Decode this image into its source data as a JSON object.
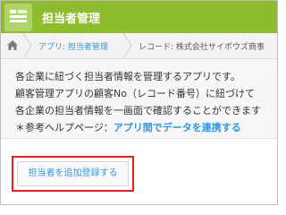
{
  "header": {
    "app_icon": "app-list-icon",
    "title": "担当者管理"
  },
  "breadcrumb": {
    "home_icon": "home-icon",
    "app": "アプリ: 担当者管理",
    "record": "レコード: 株式会社サイボウズ商事"
  },
  "description": {
    "line1": "各企業に紐づく担当者情報を管理するアプリです。",
    "line2": "顧客管理アプリの顧客No（レコード番号）に紐づけて",
    "line3": "各企業の担当者情報を一画面で確認することができます",
    "line4_prefix": "＊参考ヘルプページ：",
    "line4_link": "アプリ間でデータを連携する"
  },
  "actions": {
    "add_button": "担当者を追加登録する"
  },
  "colors": {
    "header_bg": "#8dbd2f",
    "link": "#3498db",
    "highlight_border": "#e0211c"
  }
}
